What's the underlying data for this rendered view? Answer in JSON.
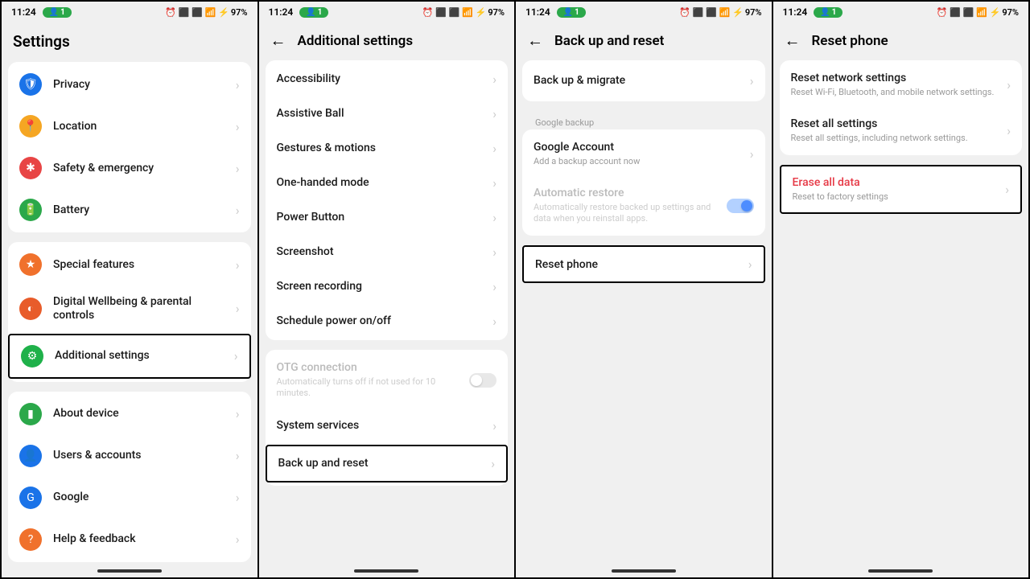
{
  "status": {
    "time": "11:24",
    "notif": "1",
    "batteryText": "97%",
    "icons": "⏰ ⚡ ᵇᵗ ˢⁱᵍ ⚡"
  },
  "screen1": {
    "title": "Settings",
    "group1": [
      {
        "label": "Privacy",
        "icon": "shield",
        "color": "ic-blue"
      },
      {
        "label": "Location",
        "icon": "pin",
        "color": "ic-yellow"
      },
      {
        "label": "Safety & emergency",
        "icon": "asterisk",
        "color": "ic-red"
      },
      {
        "label": "Battery",
        "icon": "battery",
        "color": "ic-green"
      }
    ],
    "group2": [
      {
        "label": "Special features",
        "icon": "star",
        "color": "ic-orange"
      },
      {
        "label": "Digital Wellbeing & parental controls",
        "icon": "balance",
        "color": "ic-darkorange"
      }
    ],
    "highlight": {
      "label": "Additional settings",
      "icon": "gear",
      "color": "ic-green2"
    },
    "group3": [
      {
        "label": "About device",
        "icon": "phone",
        "color": "ic-green"
      },
      {
        "label": "Users & accounts",
        "icon": "user",
        "color": "ic-blue2"
      },
      {
        "label": "Google",
        "icon": "google",
        "color": "ic-google"
      },
      {
        "label": "Help & feedback",
        "icon": "help",
        "color": "ic-orange2"
      }
    ]
  },
  "screen2": {
    "title": "Additional settings",
    "group1": [
      "Accessibility",
      "Assistive Ball",
      "Gestures & motions",
      "One-handed mode",
      "Power Button",
      "Screenshot",
      "Screen recording",
      "Schedule power on/off"
    ],
    "group2": {
      "otg_title": "OTG connection",
      "otg_sub": "Automatically turns off if not used for 10 minutes.",
      "sysservices": "System services",
      "highlight": "Back up and reset"
    }
  },
  "screen3": {
    "title": "Back up and reset",
    "row1": "Back up & migrate",
    "section": "Google backup",
    "ga_title": "Google Account",
    "ga_sub": "Add a backup account now",
    "ar_title": "Automatic restore",
    "ar_sub": "Automatically restore backed up settings and data when you reinstall apps.",
    "highlight": "Reset phone"
  },
  "screen4": {
    "title": "Reset phone",
    "rns_title": "Reset network settings",
    "rns_sub": "Reset Wi-Fi, Bluetooth, and mobile network settings.",
    "ras_title": "Reset all settings",
    "ras_sub": "Reset all settings, including network settings.",
    "erase_title": "Erase all data",
    "erase_sub": "Reset to factory settings"
  }
}
